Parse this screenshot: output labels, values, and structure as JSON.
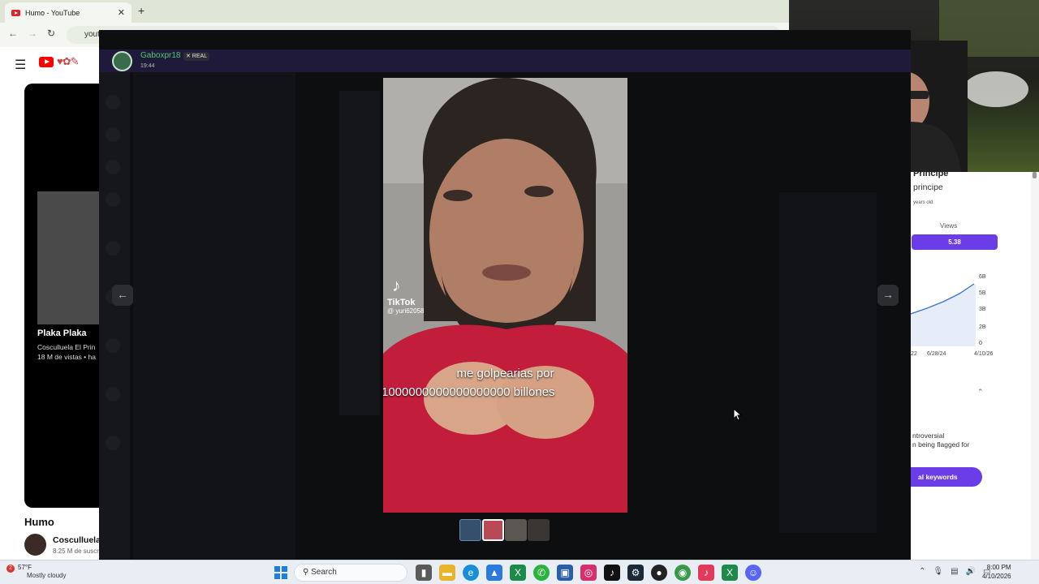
{
  "browser": {
    "tab_title": "Humo - YouTube",
    "tab_close": "✕",
    "new_tab": "+",
    "address": "yout"
  },
  "youtube": {
    "menu_icon": "☰",
    "card_title": "Plaka Plaka",
    "card_line1": "Cosculluela El Prin",
    "card_line2": "18 M de vistas • ha",
    "heading": "Humo",
    "channel": "Cosculluela",
    "subs": "8.25 M de suscr"
  },
  "stats_panel": {
    "title": "Principe",
    "subtitle": "principe",
    "mini": "years old",
    "views_label": "Views",
    "views_value": "5.38",
    "y_ticks": [
      "6B",
      "5B",
      "3B",
      "2B",
      "0"
    ],
    "x_ticks": [
      "22",
      "6/28/24",
      "4/10/26"
    ],
    "text_line1": "ntroversial",
    "text_line2": "n being flagged for",
    "button": "al keywords",
    "accent": "#6a3de8",
    "chevron": "⌃"
  },
  "viewer": {
    "username": "Gaboxpr18",
    "badge": "✕ REAL",
    "time": "19:44",
    "prev_icon": "←",
    "next_icon": "→",
    "username_color": "#4fc76c"
  },
  "media": {
    "platform_logo": "♪",
    "platform": "TikTok",
    "handle": "@ yuri62058",
    "caption_line1": "me golpearias por",
    "caption_line2": "1000000000000000000 billones"
  },
  "taskbar": {
    "weather_badge": "2",
    "temp": "57°F",
    "weather": "Mostly cloudy",
    "search_placeholder": "Search",
    "time": "8:00 PM",
    "date": "4/10/2026"
  }
}
